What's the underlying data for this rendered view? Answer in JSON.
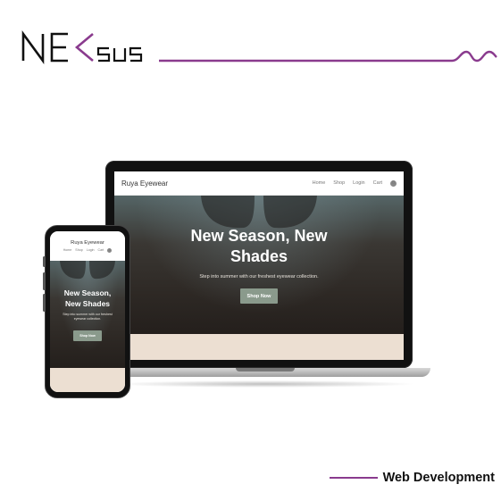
{
  "brand": {
    "logo_text": "NEKSUS",
    "accent_color": "#8a3b8e"
  },
  "site": {
    "brand_name": "Ruya Eyewear",
    "nav": [
      "Home",
      "Shop",
      "Login",
      "Cart"
    ],
    "cart_count": "0",
    "hero_title": "New Season, New Shades",
    "hero_subtitle": "Step into summer with our freshest eyewear collection.",
    "cta_label": "Shop Now",
    "button_color": "#8a9a8c",
    "band_color": "#ecdfd2"
  },
  "service": {
    "label": "Web Development"
  }
}
